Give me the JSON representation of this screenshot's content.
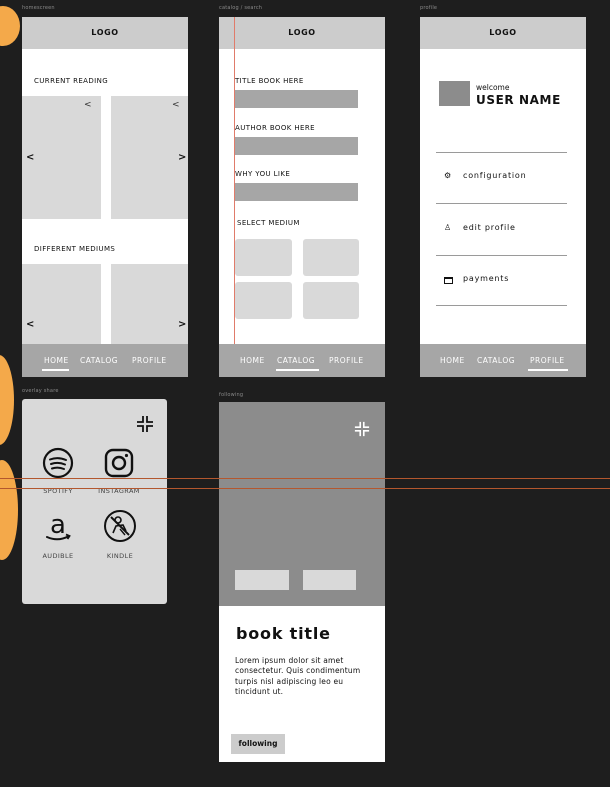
{
  "colors": {
    "background": "#1e1e1e",
    "accent": "#f4a94a",
    "topbar": "#cccccc",
    "navbar": "#a6a6a6",
    "placeholder": "#d9d9d9"
  },
  "frames": {
    "home": {
      "label": "homescreen",
      "logo": "LOGO",
      "current_reading": "CURRENT READING",
      "different_mediums": "DIFFERENT MEDIUMS",
      "prev": "<",
      "next": ">",
      "share_icon": "share-icon",
      "nav": [
        "HOME",
        "CATALOG",
        "PROFILE"
      ],
      "active_nav": "HOME"
    },
    "catalog": {
      "label": "catalog / search",
      "logo": "LOGO",
      "title_label": "TITLE BOOK HERE",
      "author_label": "AUTHOR BOOK HERE",
      "why_label": "WHY YOU LIKE",
      "medium_label": "SELECT MEDIUM",
      "nav": [
        "HOME",
        "CATALOG",
        "PROFILE"
      ],
      "active_nav": "CATALOG"
    },
    "profile": {
      "label": "profile",
      "logo": "LOGO",
      "welcome": "welcome",
      "user_name": "USER NAME",
      "menu": [
        "configuration",
        "edit profile",
        "payments"
      ],
      "menu_icons": [
        "gear-icon",
        "user-icon",
        "card-icon"
      ],
      "nav": [
        "HOME",
        "CATALOG",
        "PROFILE"
      ],
      "active_nav": "PROFILE"
    },
    "overlay": {
      "label": "overlay share",
      "collapse_icon": "collapse-icon",
      "apps": [
        "SPOTIFY",
        "INSTAGRAM",
        "AUDIBLE",
        "KINDLE"
      ],
      "app_icons": [
        "spotify-icon",
        "instagram-icon",
        "audible-icon",
        "kindle-icon"
      ]
    },
    "following": {
      "label": "following",
      "collapse_icon": "collapse-icon",
      "book_title": "book title",
      "description": "Lorem ipsum dolor sit amet consectetur. Quis condimentum turpis nisl adipiscing leo eu tincidunt ut.",
      "button": "following"
    }
  }
}
